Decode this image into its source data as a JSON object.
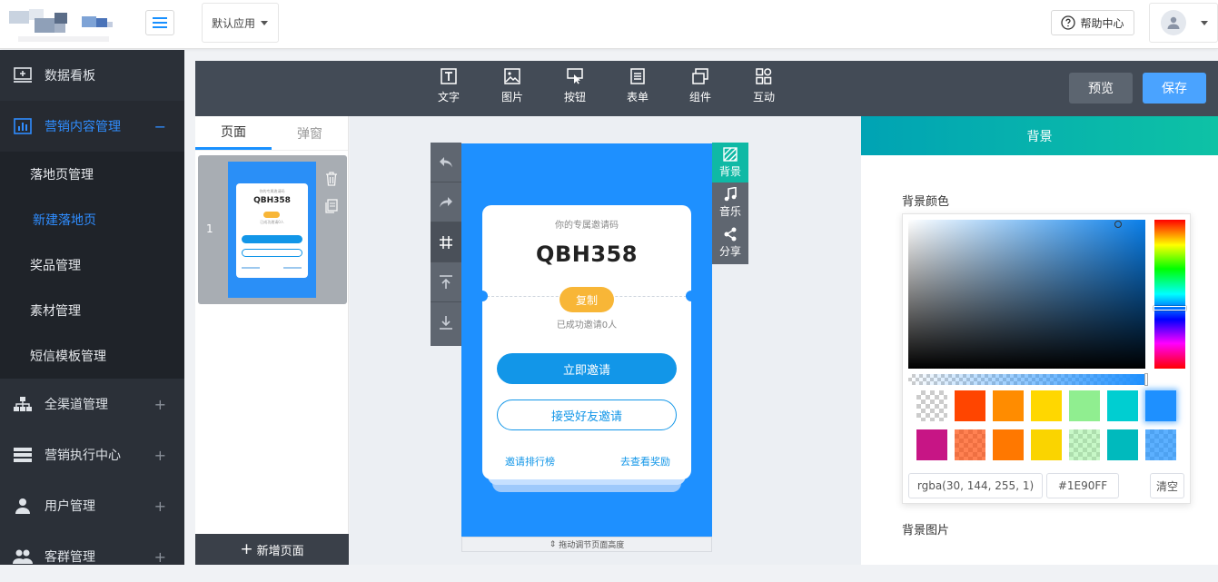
{
  "header": {
    "app_select": "默认应用",
    "help": "帮助中心"
  },
  "sidebar": {
    "items": [
      {
        "label": "数据看板",
        "toggle": ""
      },
      {
        "label": "营销内容管理",
        "toggle": "−"
      },
      {
        "label": "全渠道管理",
        "toggle": "+"
      },
      {
        "label": "营销执行中心",
        "toggle": "+"
      },
      {
        "label": "用户管理",
        "toggle": "+"
      },
      {
        "label": "客群管理",
        "toggle": "+"
      }
    ],
    "sub_items": [
      "落地页管理",
      "新建落地页",
      "奖品管理",
      "素材管理",
      "短信模板管理"
    ]
  },
  "toolbar": {
    "tools": [
      "文字",
      "图片",
      "按钮",
      "表单",
      "组件",
      "互动"
    ],
    "preview": "预览",
    "save": "保存"
  },
  "page_panel": {
    "tabs": [
      "页面",
      "弹窗"
    ],
    "page_number": "1",
    "new_page": "新增页面"
  },
  "canvas": {
    "drag_hint": "拖动调节页面高度",
    "side_tools": [
      "背景",
      "音乐",
      "分享"
    ]
  },
  "invite_card": {
    "label": "你的专属邀请码",
    "code": "QBH358",
    "copy": "复制",
    "invited": "已成功邀请0人",
    "invite_now": "立即邀请",
    "accept": "接受好友邀请",
    "rank": "邀请排行榜",
    "reward": "去查看奖励"
  },
  "settings": {
    "title": "背景",
    "bg_color_label": "背景颜色",
    "bg_image_label": "背景图片",
    "rgba": "rgba(30, 144, 255, 1)",
    "hex": "#1E90FF",
    "clear": "清空",
    "swatches": [
      "transparent",
      "#ff4500",
      "#ff8c00",
      "#ffd700",
      "#90ee90",
      "#00ced1",
      "#1e90ff",
      "#c71585",
      "rgba(255,69,0,0.68)",
      "#ff7800",
      "#fad400",
      "rgba(144,240,144,0.5)",
      "#00babd",
      "rgba(31,147,255,0.73)"
    ]
  },
  "colors": {
    "accent": "#1890ff",
    "sidebar_bg": "#2b3038",
    "phone_bg": "#1e90ff",
    "teal": "#0fb9a5"
  }
}
